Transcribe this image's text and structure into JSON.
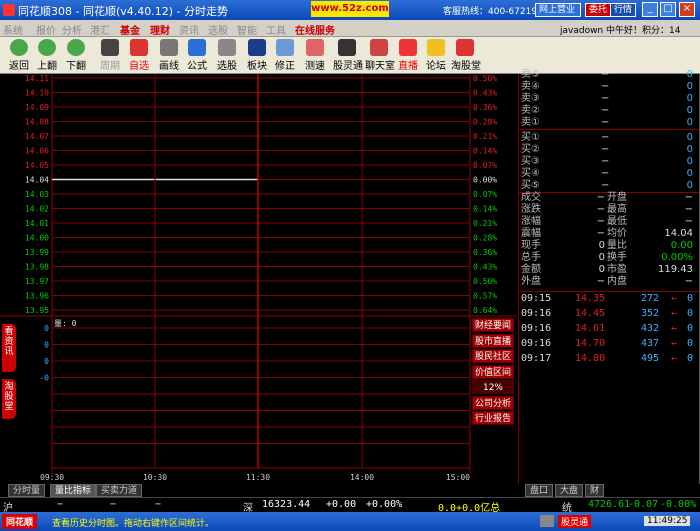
{
  "titlebar": {
    "title": "同花顺308 - 同花顺(v4.40.12) - 分时走势",
    "site": "www.52z.com",
    "hotline": "客服热线：400-6721988",
    "buttons": [
      "网上营业",
      "委托",
      "行情"
    ]
  },
  "menubar": {
    "items": [
      {
        "label": "系统",
        "hot": false
      },
      {
        "label": "报价",
        "hot": false
      },
      {
        "label": "分析",
        "hot": false
      },
      {
        "label": "港汇",
        "hot": false
      },
      {
        "label": "基金",
        "hot": true
      },
      {
        "label": "理财",
        "hot": true
      },
      {
        "label": "资讯",
        "hot": false
      },
      {
        "label": "选股",
        "hot": false
      },
      {
        "label": "智能",
        "hot": false
      },
      {
        "label": "工具",
        "hot": false
      },
      {
        "label": "在线服务",
        "hot": true
      }
    ],
    "user": "javadown 中午好！积分：14"
  },
  "toolbar": {
    "items": [
      {
        "label": "返回",
        "icon": "back-icon",
        "color": "#4aa84a"
      },
      {
        "label": "上翻",
        "icon": "up-icon",
        "color": "#4aa84a"
      },
      {
        "label": "下翻",
        "icon": "down-icon",
        "color": "#4aa84a"
      },
      {
        "label": "周期",
        "icon": "f8-icon",
        "color": "#444"
      },
      {
        "label": "自选",
        "icon": "star-icon",
        "color": "#d33"
      },
      {
        "label": "画线",
        "icon": "pen-icon",
        "color": "#777"
      },
      {
        "label": "公式",
        "icon": "formula-icon",
        "color": "#2b6fd6"
      },
      {
        "label": "选股",
        "icon": "select-icon",
        "color": "#888"
      },
      {
        "label": "板块",
        "icon": "blocks-icon",
        "color": "#1a3c8a"
      },
      {
        "label": "修正",
        "icon": "gear-icon",
        "color": "#6b9ad6"
      },
      {
        "label": "测速",
        "icon": "speed-icon",
        "color": "#d66"
      },
      {
        "label": "股灵通",
        "icon": "person-icon",
        "color": "#333"
      },
      {
        "label": "聊天室",
        "icon": "house-icon",
        "color": "#c44"
      },
      {
        "label": "直播",
        "icon": "live-icon",
        "color": "#e33"
      },
      {
        "label": "论坛",
        "icon": "bulb-icon",
        "color": "#f0c020"
      },
      {
        "label": "淘股堂",
        "icon": "cup-icon",
        "color": "#d33"
      }
    ]
  },
  "chart": {
    "price_labels": [
      "14.11",
      "14.10",
      "14.09",
      "14.08",
      "14.07",
      "14.06",
      "14.05",
      "14.04",
      "14.03",
      "14.02",
      "14.01",
      "14.00",
      "13.99",
      "13.98",
      "13.97",
      "13.96",
      "13.95"
    ],
    "pct_labels": [
      "0.50%",
      "0.43%",
      "0.36%",
      "0.28%",
      "0.21%",
      "0.14%",
      "0.07%",
      "0.00%",
      "0.07%",
      "0.14%",
      "0.21%",
      "0.28%",
      "0.36%",
      "0.43%",
      "0.50%",
      "0.57%",
      "0.64%"
    ],
    "vol_title": "量: 0",
    "vol_labels": [
      "0",
      "0",
      "0",
      "-0"
    ],
    "time_labels": [
      "09:30",
      "10:30",
      "11:30",
      "14:00",
      "15:00"
    ],
    "side_buttons": [
      "财经要闻",
      "股市直播",
      "股民社区",
      "价值区间",
      "12%",
      "公司分析",
      "行业报告"
    ],
    "vtabs": [
      "看资讯",
      "淘股堂"
    ]
  },
  "bottom_tabs": [
    "分时量",
    "量比指标",
    "买卖力道"
  ],
  "right_tabs": [
    "盘口",
    "大盘",
    "财"
  ],
  "indexbar": {
    "sh_label": "沪",
    "sh_dash": "−",
    "sz_label": "深",
    "sz_value": "16323.44",
    "sz_change": "+0.00",
    "sz_pct": "+0.00%",
    "sz_vol": "0.0+0.0亿总",
    "a_label": "统",
    "a_value": "4726.61",
    "a_change": "-0.07",
    "a_pct": "-0.00%"
  },
  "statusbar": {
    "brand": "同花顺",
    "message": "查看历史分时图。拖动右键作区间统计。",
    "chip": "股灵通",
    "time": "11:49:25"
  },
  "orderbook": {
    "sells": [
      {
        "k": "卖⑤",
        "p": "−",
        "v": "0"
      },
      {
        "k": "卖④",
        "p": "−",
        "v": "0"
      },
      {
        "k": "卖③",
        "p": "−",
        "v": "0"
      },
      {
        "k": "卖②",
        "p": "−",
        "v": "0"
      },
      {
        "k": "卖①",
        "p": "−",
        "v": "0"
      }
    ],
    "buys": [
      {
        "k": "买①",
        "p": "−",
        "v": "0"
      },
      {
        "k": "买②",
        "p": "−",
        "v": "0"
      },
      {
        "k": "买③",
        "p": "−",
        "v": "0"
      },
      {
        "k": "买④",
        "p": "−",
        "v": "0"
      },
      {
        "k": "买⑤",
        "p": "−",
        "v": "0"
      }
    ],
    "stats": [
      {
        "a": "成交",
        "av": "−",
        "b": "开盘",
        "bv": "−"
      },
      {
        "a": "涨跌",
        "av": "−",
        "b": "最高",
        "bv": "−"
      },
      {
        "a": "涨幅",
        "av": "−",
        "b": "最低",
        "bv": "−"
      },
      {
        "a": "震幅",
        "av": "−",
        "b": "均价",
        "bv": "14.04"
      },
      {
        "a": "现手",
        "av": "0",
        "b": "量比",
        "bv": "0.00"
      },
      {
        "a": "总手",
        "av": "0",
        "b": "换手",
        "bv": "0.00%"
      },
      {
        "a": "金额",
        "av": "0",
        "b": "市盈",
        "bv": "119.43"
      },
      {
        "a": "外盘",
        "av": "−",
        "b": "内盘",
        "bv": "−"
      }
    ],
    "ticks": [
      {
        "t": "09:15",
        "p": "14.35",
        "v": "272",
        "d": "←",
        "z": "0"
      },
      {
        "t": "09:16",
        "p": "14.45",
        "v": "352",
        "d": "←",
        "z": "0"
      },
      {
        "t": "09:16",
        "p": "14.61",
        "v": "432",
        "d": "←",
        "z": "0"
      },
      {
        "t": "09:16",
        "p": "14.70",
        "v": "437",
        "d": "←",
        "z": "0"
      },
      {
        "t": "09:17",
        "p": "14.80",
        "v": "495",
        "d": "←",
        "z": "0"
      }
    ]
  }
}
